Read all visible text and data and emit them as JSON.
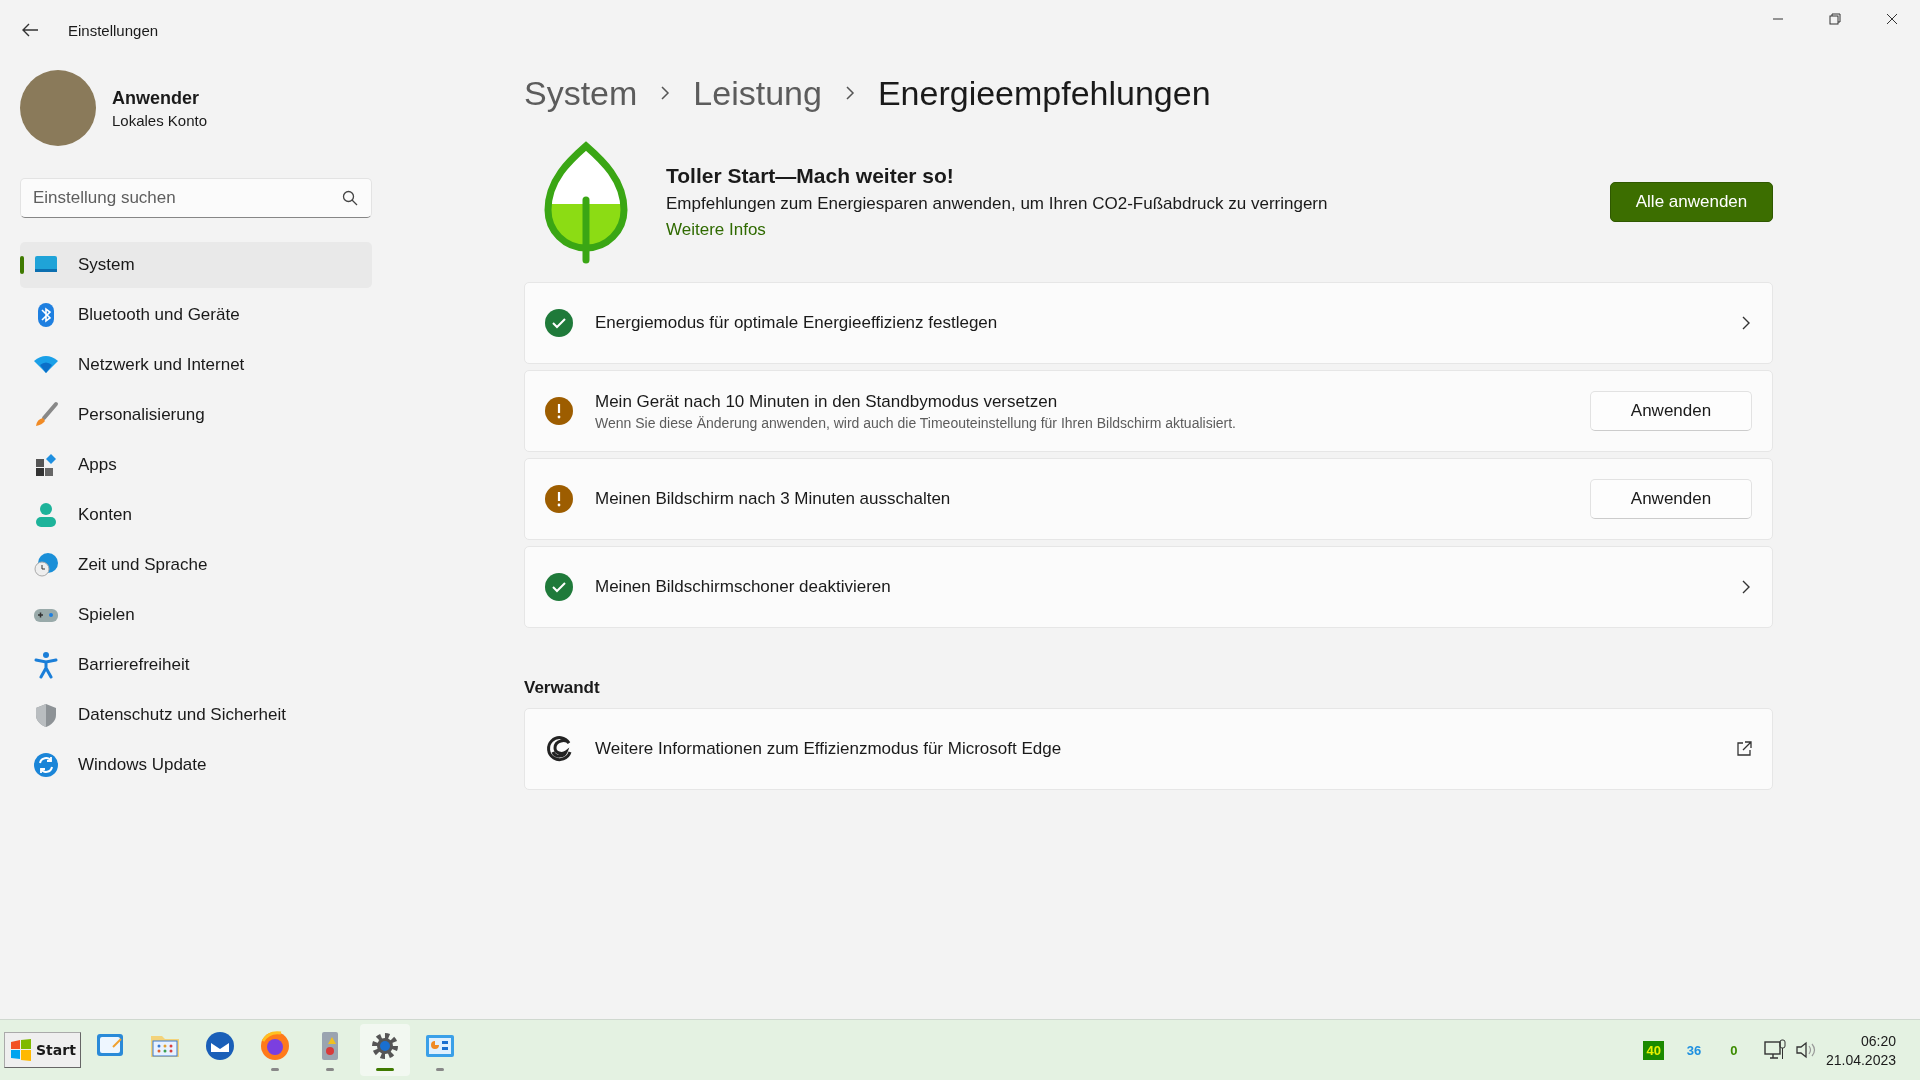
{
  "window": {
    "title": "Einstellungen"
  },
  "user": {
    "name": "Anwender",
    "account": "Lokales Konto"
  },
  "search": {
    "placeholder": "Einstellung suchen"
  },
  "sidebar": {
    "items": [
      {
        "label": "System",
        "selected": true
      },
      {
        "label": "Bluetooth und Geräte",
        "selected": false
      },
      {
        "label": "Netzwerk und Internet",
        "selected": false
      },
      {
        "label": "Personalisierung",
        "selected": false
      },
      {
        "label": "Apps",
        "selected": false
      },
      {
        "label": "Konten",
        "selected": false
      },
      {
        "label": "Zeit und Sprache",
        "selected": false
      },
      {
        "label": "Spielen",
        "selected": false
      },
      {
        "label": "Barrierefreiheit",
        "selected": false
      },
      {
        "label": "Datenschutz und Sicherheit",
        "selected": false
      },
      {
        "label": "Windows Update",
        "selected": false
      }
    ]
  },
  "breadcrumb": [
    "System",
    "Leistung",
    "Energieempfehlungen"
  ],
  "hero": {
    "title": "Toller Start—Mach weiter so!",
    "text": "Empfehlungen zum Energiesparen anwenden, um Ihren CO2-Fußabdruck zu verringern",
    "link": "Weitere Infos",
    "button": "Alle anwenden"
  },
  "recommendations": [
    {
      "kind": "link",
      "completed": true,
      "title": "Energiemodus für optimale Energieeffizienz festlegen"
    },
    {
      "kind": "button",
      "completed": false,
      "title": "Mein Gerät nach 10 Minuten in den Standbymodus versetzen",
      "description": "Wenn Sie diese Änderung anwenden, wird auch die Timeouteinstellung für Ihren Bildschirm aktualisiert.",
      "button": "Anwenden"
    },
    {
      "kind": "button",
      "completed": false,
      "title": "Meinen Bildschirm nach 3 Minuten ausschalten",
      "button": "Anwenden"
    },
    {
      "kind": "link",
      "completed": true,
      "title": "Meinen Bildschirmschoner deaktivieren"
    }
  ],
  "related": {
    "heading": "Verwandt",
    "items": [
      {
        "title": "Weitere Informationen zum Effizienzmodus für Microsoft Edge"
      }
    ]
  },
  "taskbar": {
    "start": "Start",
    "apps": [
      {
        "running": false,
        "selected": false
      },
      {
        "running": false,
        "selected": false
      },
      {
        "running": false,
        "selected": false
      },
      {
        "running": true,
        "selected": false
      },
      {
        "running": true,
        "selected": false
      },
      {
        "running": true,
        "selected": true
      },
      {
        "running": true,
        "selected": false
      }
    ],
    "tray_counters": [
      {
        "text": "40",
        "kind": "badge"
      },
      {
        "text": "36",
        "kind": "plain"
      },
      {
        "text": "0",
        "kind": "plain"
      }
    ],
    "time": "06:20",
    "date": "21.04.2023"
  }
}
